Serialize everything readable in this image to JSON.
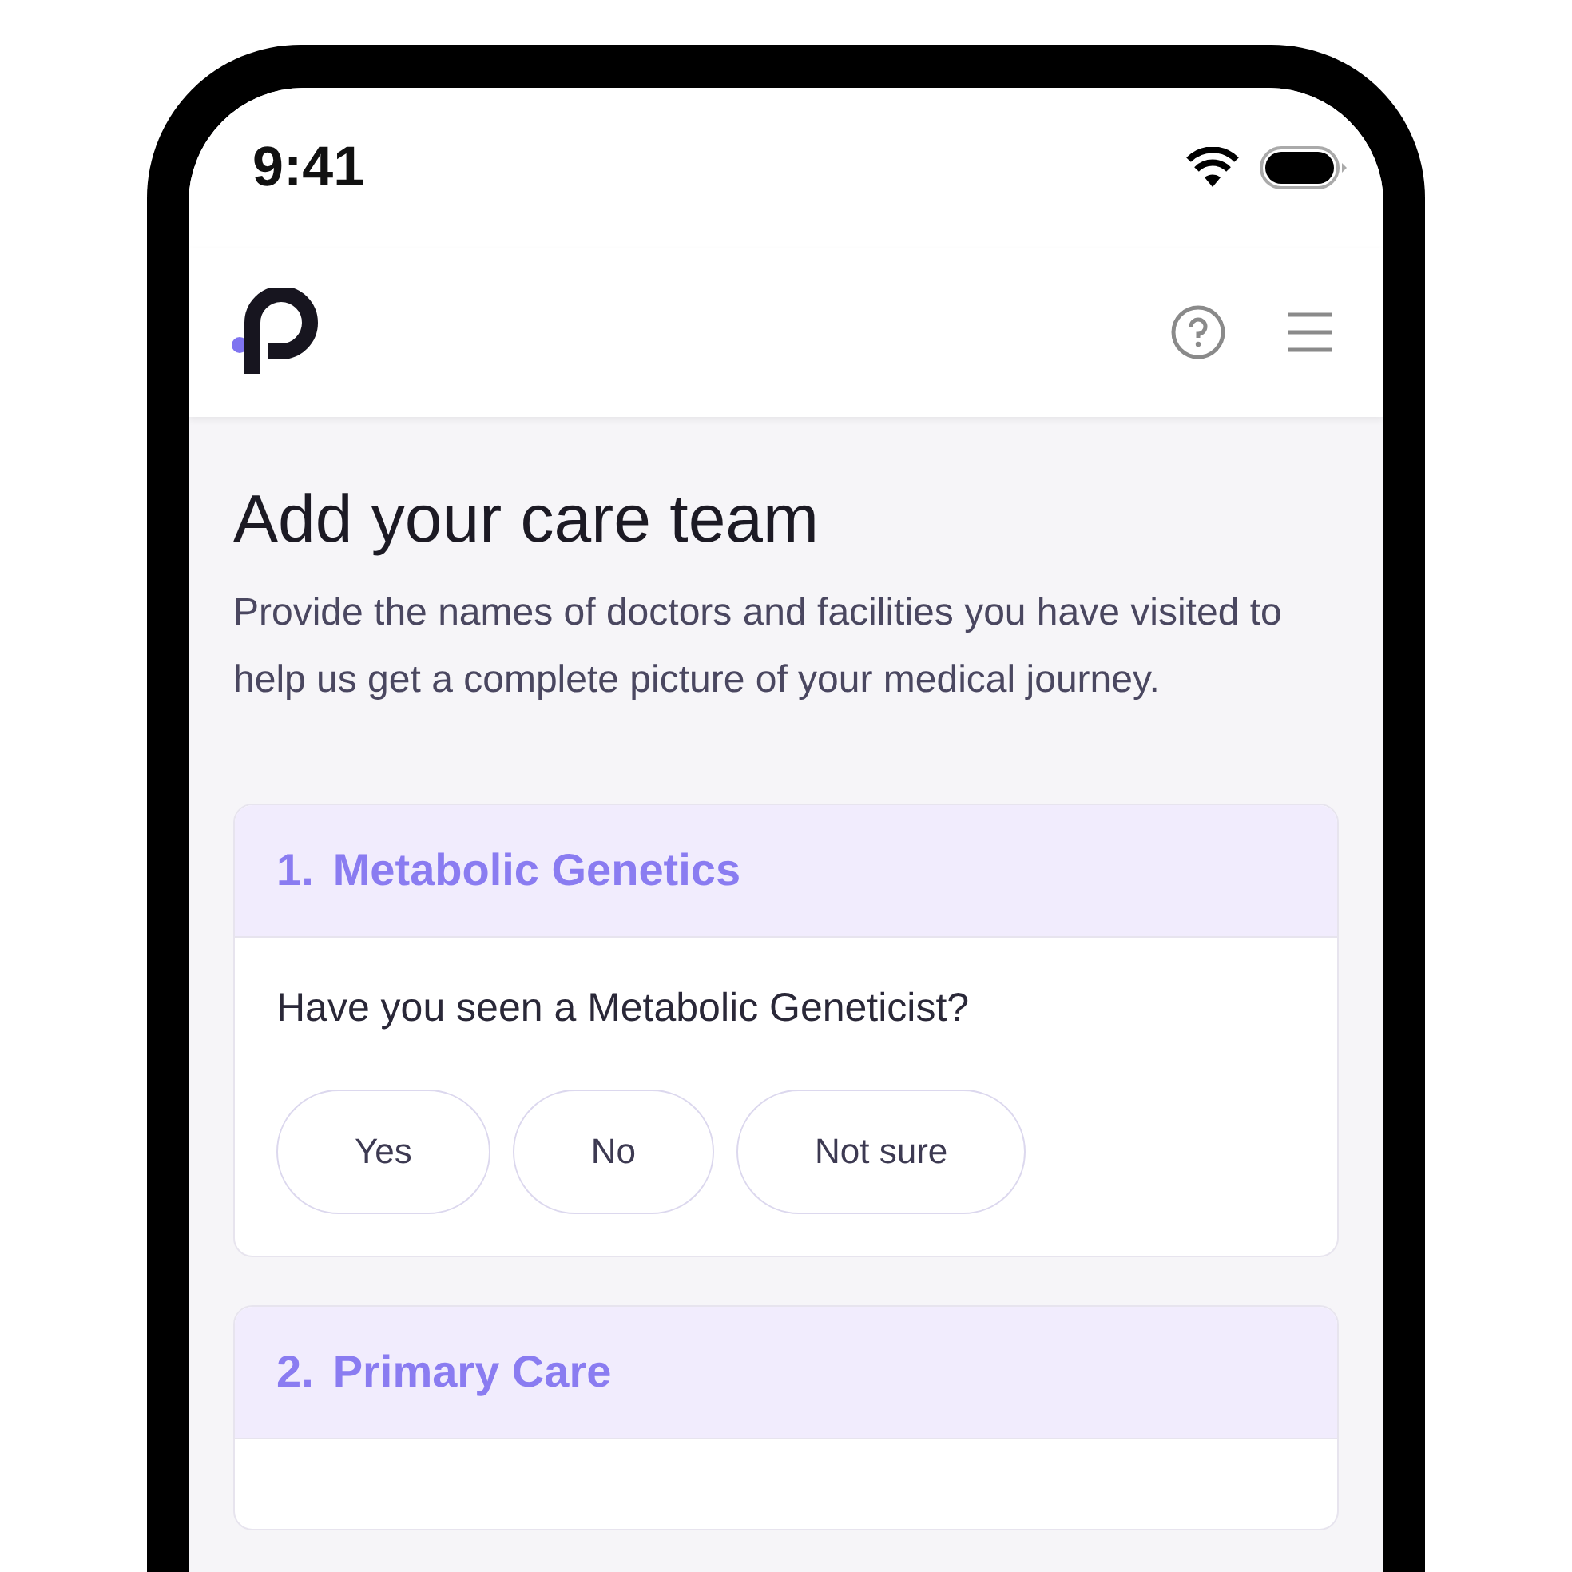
{
  "status_bar": {
    "time": "9:41"
  },
  "page": {
    "title": "Add your care team",
    "description": "Provide the names of doctors and facilities you have visited to help us get a complete picture of your medical journey."
  },
  "sections": [
    {
      "number": "1.",
      "title": "Metabolic Genetics",
      "question": "Have you seen a Metabolic Geneticist?",
      "options": [
        {
          "label": "Yes",
          "selected": false
        },
        {
          "label": "No",
          "selected": false
        },
        {
          "label": "Not sure",
          "selected": false
        }
      ]
    },
    {
      "number": "2.",
      "title": "Primary Care"
    }
  ]
}
